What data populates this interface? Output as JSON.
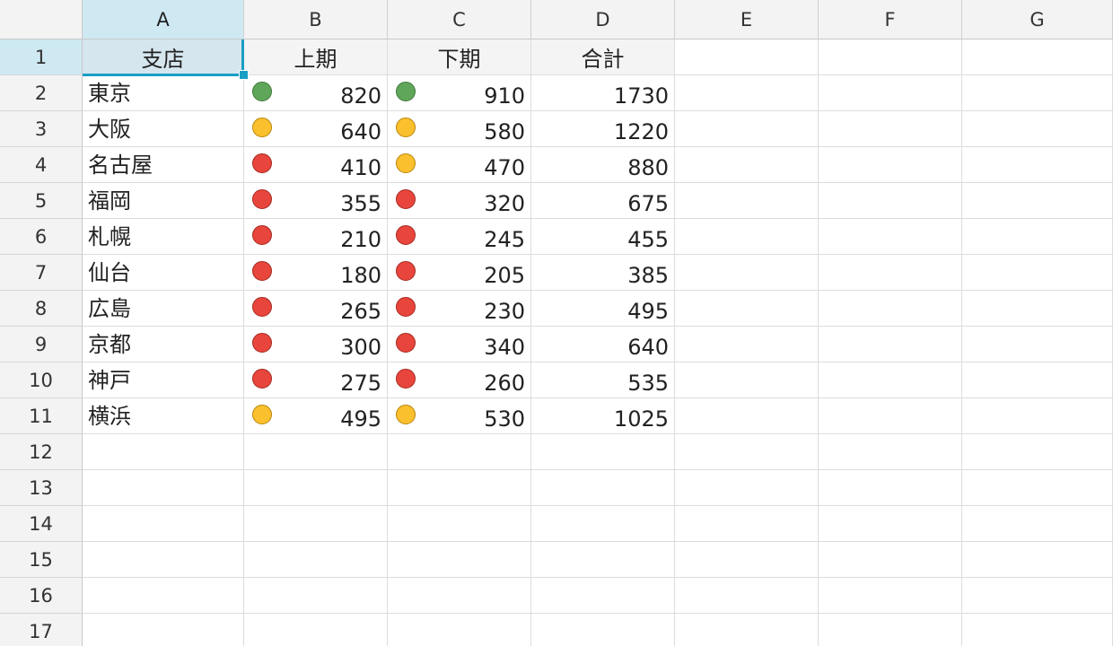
{
  "columns": [
    "A",
    "B",
    "C",
    "D",
    "E",
    "F",
    "G"
  ],
  "rows": [
    "1",
    "2",
    "3",
    "4",
    "5",
    "6",
    "7",
    "8",
    "9",
    "10",
    "11",
    "12",
    "13",
    "14",
    "15",
    "16",
    "17"
  ],
  "selected_cell": "A1",
  "headers": {
    "branch": "支店",
    "first_half": "上期",
    "second_half": "下期",
    "total": "合計"
  },
  "indicator_colors": {
    "green": "#5fa65a",
    "yellow": "#fbc02d",
    "red": "#e8453c"
  },
  "data_rows": [
    {
      "branch": "東京",
      "first_half": "820",
      "first_icon": "green",
      "second_half": "910",
      "second_icon": "green",
      "total": "1730"
    },
    {
      "branch": "大阪",
      "first_half": "640",
      "first_icon": "yellow",
      "second_half": "580",
      "second_icon": "yellow",
      "total": "1220"
    },
    {
      "branch": "名古屋",
      "first_half": "410",
      "first_icon": "red",
      "second_half": "470",
      "second_icon": "yellow",
      "total": "880"
    },
    {
      "branch": "福岡",
      "first_half": "355",
      "first_icon": "red",
      "second_half": "320",
      "second_icon": "red",
      "total": "675"
    },
    {
      "branch": "札幌",
      "first_half": "210",
      "first_icon": "red",
      "second_half": "245",
      "second_icon": "red",
      "total": "455"
    },
    {
      "branch": "仙台",
      "first_half": "180",
      "first_icon": "red",
      "second_half": "205",
      "second_icon": "red",
      "total": "385"
    },
    {
      "branch": "広島",
      "first_half": "265",
      "first_icon": "red",
      "second_half": "230",
      "second_icon": "red",
      "total": "495"
    },
    {
      "branch": "京都",
      "first_half": "300",
      "first_icon": "red",
      "second_half": "340",
      "second_icon": "red",
      "total": "640"
    },
    {
      "branch": "神戸",
      "first_half": "275",
      "first_icon": "red",
      "second_half": "260",
      "second_icon": "red",
      "total": "535"
    },
    {
      "branch": "横浜",
      "first_half": "495",
      "first_icon": "yellow",
      "second_half": "530",
      "second_icon": "yellow",
      "total": "1025"
    }
  ]
}
